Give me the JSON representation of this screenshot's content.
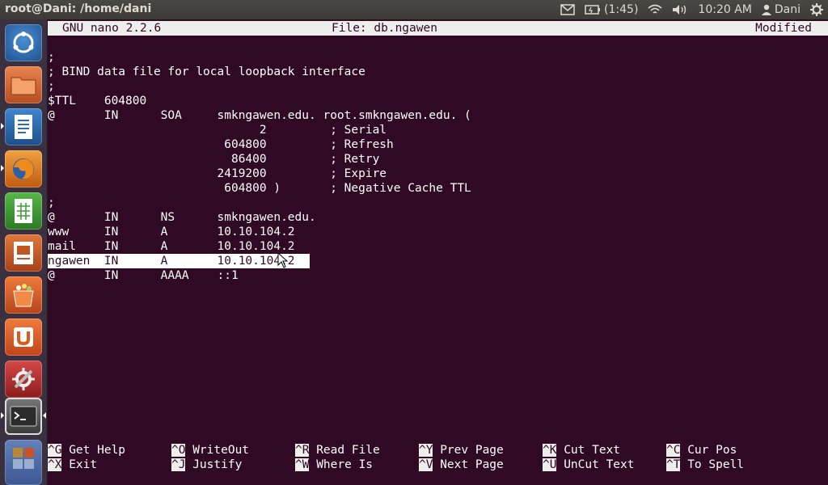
{
  "window_title": "root@Dani: /home/dani",
  "indicators": {
    "battery_text": "(1:45)",
    "clock": "10:20 AM",
    "user": "Dani"
  },
  "nano": {
    "version": "GNU nano 2.2.6",
    "file": "File: db.ngawen",
    "state": "Modified"
  },
  "buffer_lines": [
    ";",
    "; BIND data file for local loopback interface",
    ";",
    "$TTL    604800",
    "@       IN      SOA     smkngawen.edu. root.smkngawen.edu. (",
    "                              2         ; Serial",
    "                         604800         ; Refresh",
    "                          86400         ; Retry",
    "                        2419200         ; Expire",
    "                         604800 )       ; Negative Cache TTL",
    ";",
    "@       IN      NS      smkngawen.edu.",
    "www     IN      A       10.10.104.2",
    "mail    IN      A       10.10.104.2",
    "ngawen  IN      A       10.10.104.2",
    "@       IN      AAAA    ::1"
  ],
  "shortcuts": [
    {
      "key": "^G",
      "label": "Get Help"
    },
    {
      "key": "^X",
      "label": "Exit"
    },
    {
      "key": "^O",
      "label": "WriteOut"
    },
    {
      "key": "^J",
      "label": "Justify"
    },
    {
      "key": "^R",
      "label": "Read File"
    },
    {
      "key": "^W",
      "label": "Where Is"
    },
    {
      "key": "^Y",
      "label": "Prev Page"
    },
    {
      "key": "^V",
      "label": "Next Page"
    },
    {
      "key": "^K",
      "label": "Cut Text"
    },
    {
      "key": "^U",
      "label": "UnCut Text"
    },
    {
      "key": "^C",
      "label": "Cur Pos"
    },
    {
      "key": "^T",
      "label": "To Spell"
    }
  ],
  "launcher_items": [
    {
      "name": "dash-home-icon",
      "color": "#2a6fb8"
    },
    {
      "name": "files-icon",
      "color": "#c85a2a"
    },
    {
      "name": "libreoffice-writer-icon",
      "color": "#2e6dac"
    },
    {
      "name": "firefox-icon",
      "color": "#e3791d"
    },
    {
      "name": "libreoffice-calc-icon",
      "color": "#3d9c34"
    },
    {
      "name": "libreoffice-impress-icon",
      "color": "#c2561e"
    },
    {
      "name": "software-center-icon",
      "color": "#d9571c"
    },
    {
      "name": "ubuntu-one-icon",
      "color": "#de5a1b"
    },
    {
      "name": "system-settings-icon",
      "color": "#c4282a"
    },
    {
      "name": "terminal-icon",
      "color": "#5d5d5d"
    }
  ]
}
